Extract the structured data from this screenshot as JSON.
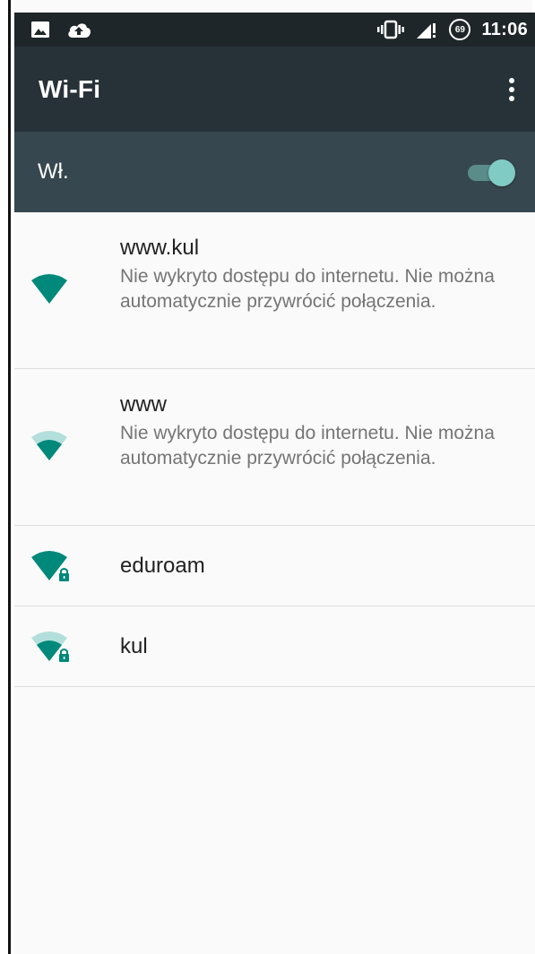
{
  "status_bar": {
    "time": "11:06",
    "battery_level": "69",
    "left_icons": [
      "image-icon",
      "cloud-upload-icon"
    ],
    "right_icons": [
      "vibrate-icon",
      "signal-icon",
      "battery-icon"
    ]
  },
  "app_bar": {
    "title": "Wi-Fi",
    "menu_icon": "overflow-menu-icon"
  },
  "master_switch": {
    "label": "Wł.",
    "state": "on"
  },
  "networks": [
    {
      "ssid": "www.kul",
      "status": "Nie wykryto dostępu do internetu. Nie można automatycznie przywrócić połączenia.",
      "secured": false,
      "signal": "full"
    },
    {
      "ssid": "www",
      "status": "Nie wykryto dostępu do internetu. Nie można automatycznie przywrócić połączenia.",
      "secured": false,
      "signal": "medium"
    },
    {
      "ssid": "eduroam",
      "status": "",
      "secured": true,
      "signal": "full"
    },
    {
      "ssid": "kul",
      "status": "",
      "secured": true,
      "signal": "medium"
    }
  ],
  "colors": {
    "status_bar_bg": "#1f2629",
    "app_bar_bg": "#263238",
    "switch_bar_bg": "#37474f",
    "accent": "#80cbc4",
    "wifi_icon": "#00897b"
  }
}
